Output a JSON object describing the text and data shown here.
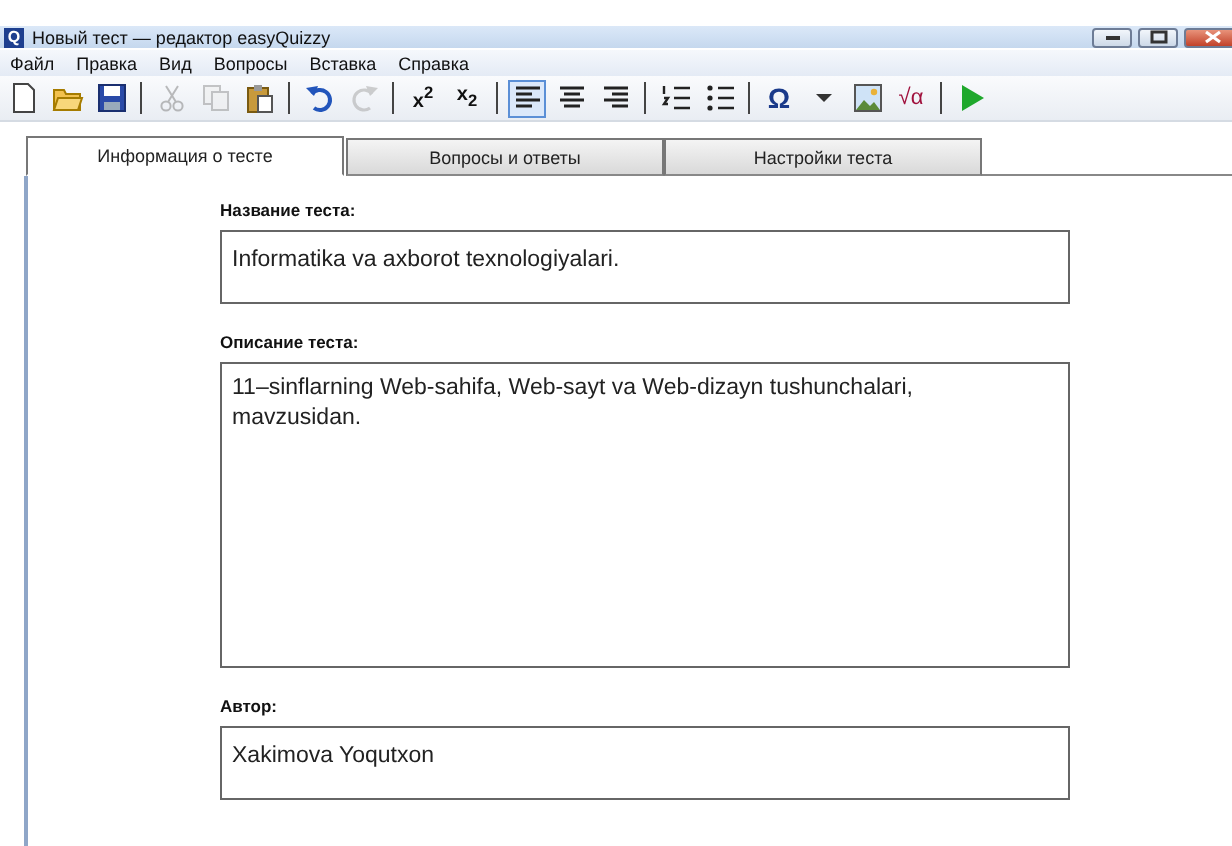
{
  "window": {
    "app_icon": "Q",
    "title": "Новый тест — редактор easyQuizzy"
  },
  "menu": [
    "Файл",
    "Правка",
    "Вид",
    "Вопросы",
    "Вставка",
    "Справка"
  ],
  "toolbar": [
    [
      {
        "disabled": false,
        "selected": false
      },
      {
        "disabled": false,
        "selected": false
      },
      {
        "disabled": false,
        "selected": false
      }
    ],
    [
      {
        "disabled": true,
        "selected": false
      },
      {
        "disabled": true,
        "selected": false
      },
      {
        "disabled": false,
        "selected": false
      }
    ],
    [
      {
        "disabled": false,
        "selected": false
      },
      {
        "disabled": true,
        "selected": false
      }
    ],
    [
      {
        "glyph": "x$^{2}$",
        "disabled": false,
        "selected": false
      },
      {
        "glyph": "x$_{2}$",
        "disabled": false,
        "selected": false
      }
    ],
    [
      {
        "disabled": false,
        "selected": true
      },
      {
        "disabled": false,
        "selected": false
      },
      {
        "disabled": false,
        "selected": false
      }
    ],
    [
      {
        "disabled": false,
        "selected": false
      },
      {
        "disabled": false,
        "selected": false
      }
    ],
    [
      {
        "glyph": "Ω",
        "disabled": false,
        "selected": false
      },
      {
        "disabled": false,
        "selected": false
      },
      {
        "disabled": false,
        "selected": false
      },
      {
        "glyph": "√α",
        "disabled": false,
        "selected": false
      }
    ],
    [
      {
        "disabled": false,
        "selected": false
      }
    ]
  ],
  "tabs": [
    {
      "label": "Информация о тесте",
      "selected": true
    },
    {
      "label": "Вопросы и ответы",
      "selected": false
    },
    {
      "label": "Настройки теста",
      "selected": false
    }
  ],
  "fields": [
    {
      "label": "Название теста:",
      "value": "Informatika va axborot texnologiyalari.",
      "kind": "line"
    },
    {
      "label": "Описание теста:",
      "value": "11–sinflarning Web-sahifa, Web-sayt va Web-dizayn tushunchalari, mavzusidan.",
      "kind": "area"
    },
    {
      "label": "Автор:",
      "value": "Xakimova Yoqutxon",
      "kind": "line"
    }
  ]
}
